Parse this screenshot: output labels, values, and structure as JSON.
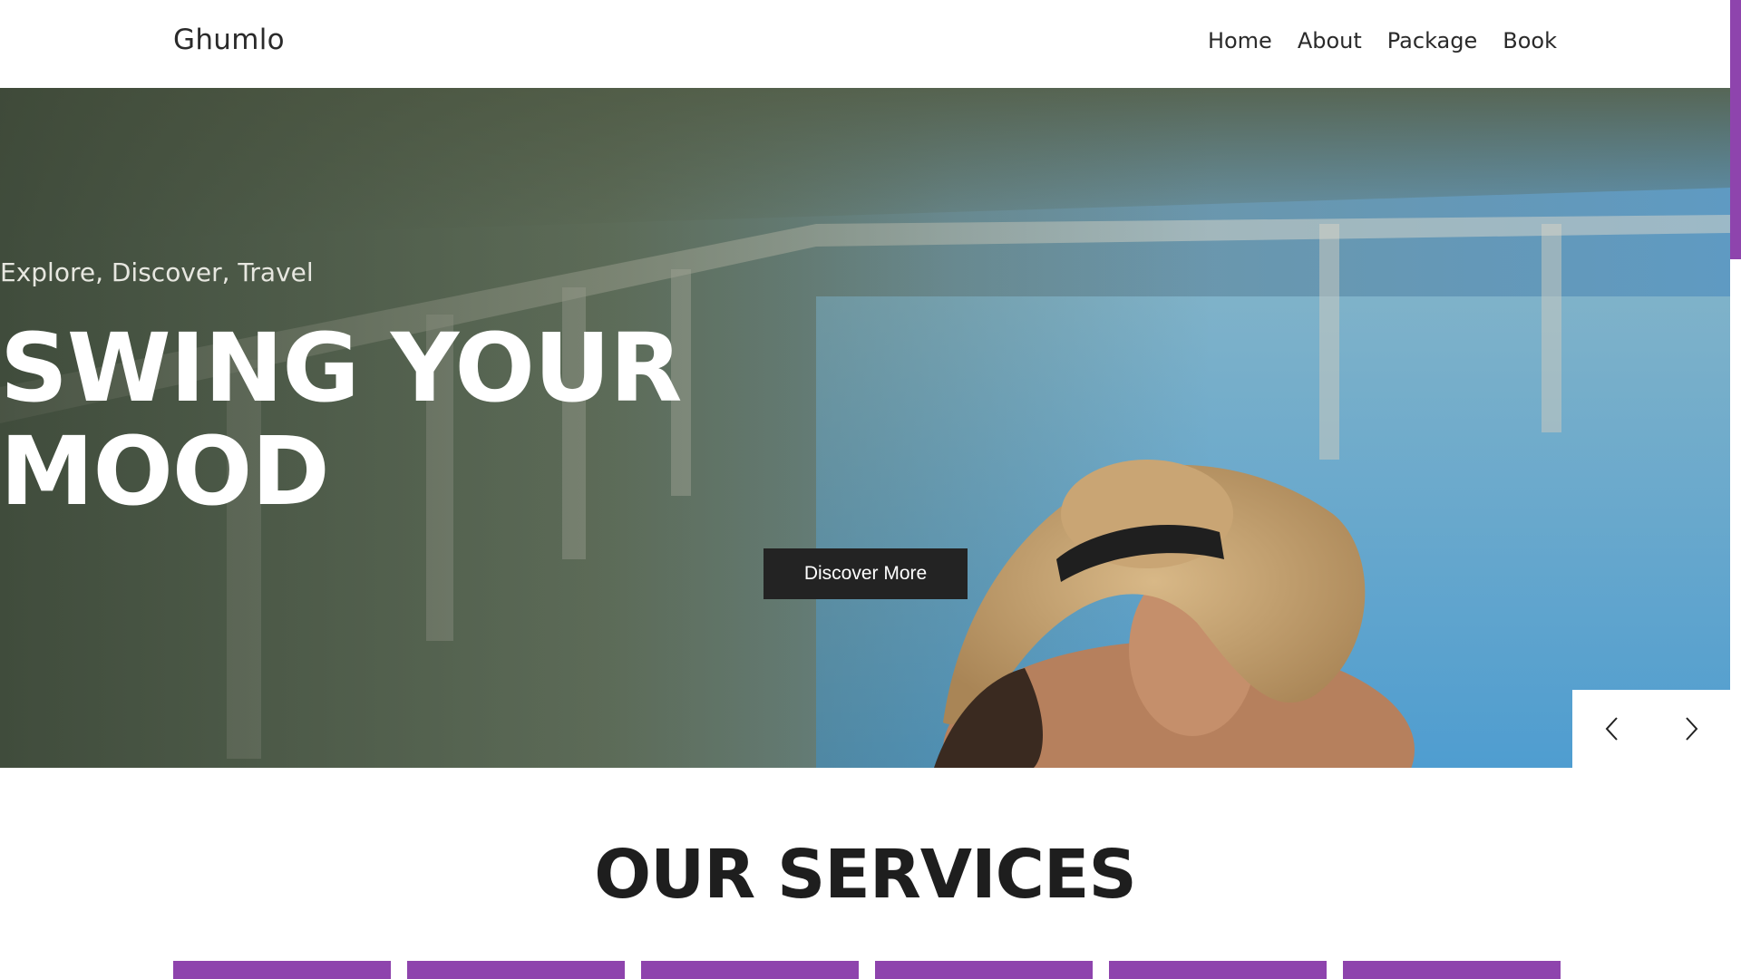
{
  "header": {
    "logo": "Ghumlo",
    "nav": [
      "Home",
      "About",
      "Package",
      "Book"
    ]
  },
  "hero": {
    "subtitle": "Explore, Discover, Travel",
    "title_line1": "SWING YOUR",
    "title_line2": "MOOD",
    "cta_label": "Discover More"
  },
  "slider": {
    "prev_icon": "chevron-left-icon",
    "next_icon": "chevron-right-icon"
  },
  "services": {
    "title": "OUR SERVICES"
  },
  "colors": {
    "accent": "#8e44ad",
    "button": "#232323"
  }
}
